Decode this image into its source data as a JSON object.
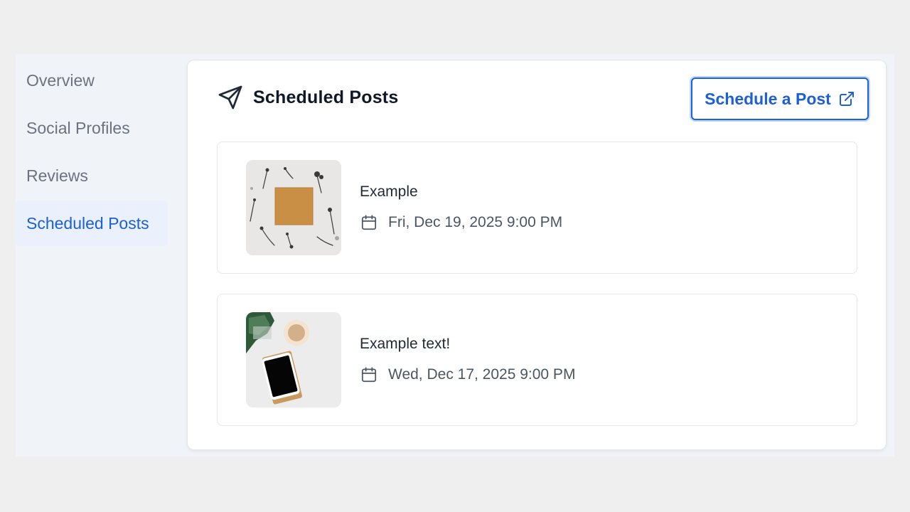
{
  "sidebar": {
    "items": [
      {
        "label": "Overview",
        "active": false
      },
      {
        "label": "Social Profiles",
        "active": false
      },
      {
        "label": "Reviews",
        "active": false
      },
      {
        "label": "Scheduled Posts",
        "active": true
      }
    ]
  },
  "panel": {
    "title": "Scheduled Posts",
    "title_icon": "send-icon",
    "schedule_button_label": "Schedule a Post",
    "schedule_button_icon": "external-link-icon"
  },
  "posts": [
    {
      "text": "Example",
      "date": "Fri, Dec 19, 2025 9:00 PM",
      "date_icon": "calendar-icon",
      "thumbnail": "flat-lay with cork square and dried flowers"
    },
    {
      "text": "Example text!",
      "date": "Wed, Dec 17, 2025 9:00 PM",
      "date_icon": "calendar-icon",
      "thumbnail": "desk flat-lay with tablet, coffee cup and leaves"
    }
  ],
  "colors": {
    "accent": "#1d5fd6",
    "active_nav_bg": "#eaf1fd",
    "nav_text": "#6b7280",
    "page_bg": "#efefef",
    "frame_bg": "#f0f3f8"
  }
}
